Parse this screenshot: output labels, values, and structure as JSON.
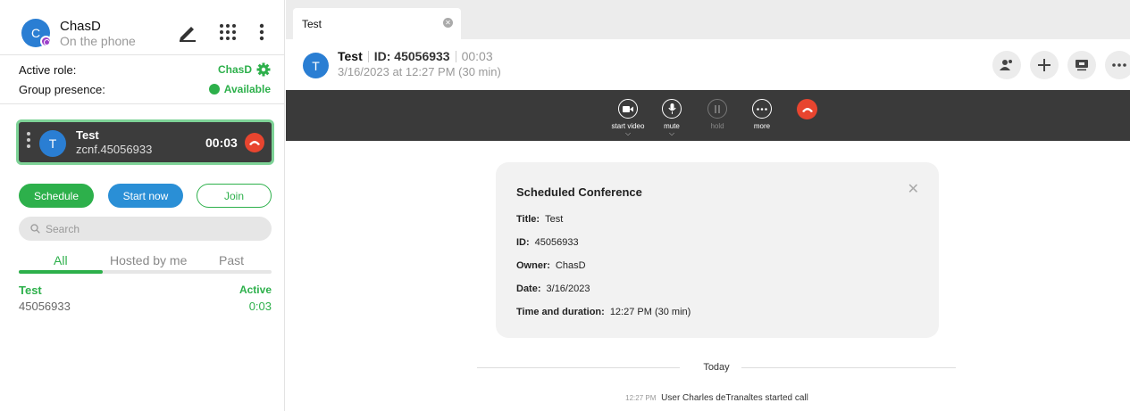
{
  "user": {
    "initial": "C",
    "name": "ChasD",
    "status": "On the phone"
  },
  "toolbar": {
    "compose_icon": "pencil-icon",
    "apps_icon": "grid-icon",
    "menu_icon": "kebab-icon"
  },
  "role": {
    "active_role_label": "Active role:",
    "active_role_value": "ChasD",
    "group_presence_label": "Group presence:",
    "group_presence_value": "Available"
  },
  "active_call": {
    "initial": "T",
    "name": "Test",
    "address": "zcnf.45056933",
    "timer": "00:03"
  },
  "actions": {
    "schedule": "Schedule",
    "start_now": "Start now",
    "join": "Join"
  },
  "search": {
    "placeholder": "Search"
  },
  "tabs": [
    {
      "label": "All"
    },
    {
      "label": "Hosted by me"
    },
    {
      "label": "Past"
    }
  ],
  "conferences": [
    {
      "title": "Test",
      "id": "45056933",
      "state": "Active",
      "duration": "0:03"
    }
  ],
  "window_tab": {
    "label": "Test"
  },
  "header": {
    "initial": "T",
    "name": "Test",
    "id_label": "ID: 45056933",
    "timer": "00:03",
    "datetime": "3/16/2023 at 12:27 PM (30 min)"
  },
  "call_controls": [
    {
      "label": "start video",
      "icon": "video-icon",
      "has_menu": true
    },
    {
      "label": "mute",
      "icon": "microphone-icon",
      "has_menu": true
    },
    {
      "label": "hold",
      "icon": "pause-icon",
      "has_menu": false
    },
    {
      "label": "more",
      "icon": "more-icon",
      "has_menu": false
    }
  ],
  "scheduled": {
    "heading": "Scheduled Conference",
    "title_label": "Title:",
    "title_value": "Test",
    "id_label": "ID:",
    "id_value": "45056933",
    "owner_label": "Owner:",
    "owner_value": "ChasD",
    "date_label": "Date:",
    "date_value": "3/16/2023",
    "time_label": "Time and duration:",
    "time_value": "12:27 PM (30 min)"
  },
  "chat": {
    "divider": "Today",
    "log_time": "12:27 PM",
    "log_text": "User Charles deTranaltes started call"
  },
  "colors": {
    "accent_green": "#2db04b",
    "brand_blue": "#2a7ed3",
    "hangup_red": "#e8452f",
    "call_bar": "#3a3a3a"
  }
}
